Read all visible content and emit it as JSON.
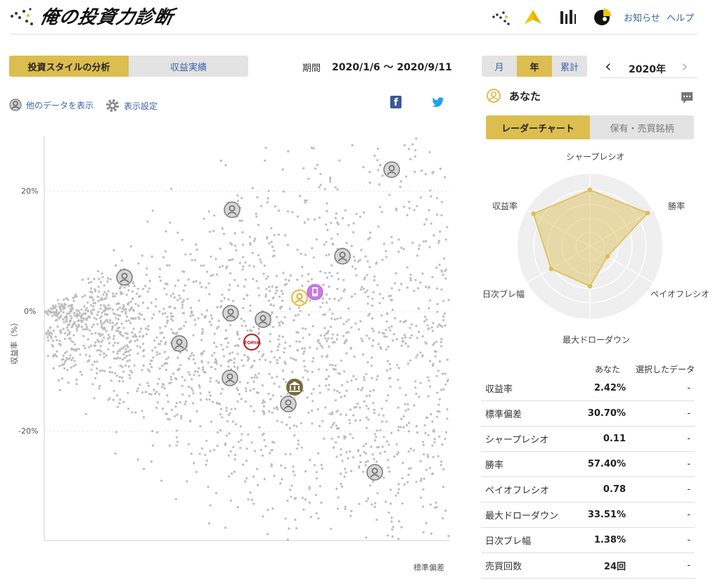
{
  "header": {
    "logo_text": "俺の投資力診断",
    "links": {
      "news": "お知らせ",
      "help": "ヘルプ"
    },
    "icons": [
      "dots-logo-icon",
      "yellow-triangle-icon",
      "bar-chart-icon",
      "pie-chart-icon"
    ]
  },
  "main_tabs": {
    "style": "投資スタイルの分析",
    "results": "収益実績"
  },
  "period": {
    "label": "期間",
    "value": "2020/1/6 〜 2020/9/11"
  },
  "range_tabs": {
    "month": "月",
    "year": "年",
    "total": "累計"
  },
  "year_nav": {
    "prev": "‹",
    "value": "2020年",
    "next": "›"
  },
  "toolbar": {
    "other_data": "他のデータを表示",
    "display_settings": "表示設定"
  },
  "share": {
    "facebook": "f",
    "twitter": "twitter"
  },
  "scatter": {
    "x_label": "標準偏差",
    "y_label": "収益率（%）",
    "y_ticks": [
      "20%",
      "0%",
      "-20%"
    ],
    "topix_label": "TOPIX"
  },
  "user_panel": {
    "title": "あなた"
  },
  "sub_tabs": {
    "radar": "レーダーチャート",
    "holdings": "保有・売買銘柄"
  },
  "radar": {
    "axes": [
      "シャープレシオ",
      "勝率",
      "ペイオフレシオ",
      "最大ドローダウン",
      "日次ブレ幅",
      "収益率"
    ],
    "values": [
      0.78,
      0.92,
      0.28,
      0.55,
      0.62,
      0.9
    ],
    "color": "#dcbd4f"
  },
  "table": {
    "headers": [
      "",
      "あなた",
      "選択したデータ"
    ],
    "rows": [
      {
        "label": "収益率",
        "you": "2.42%",
        "selected": "-"
      },
      {
        "label": "標準偏差",
        "you": "30.70%",
        "selected": "-"
      },
      {
        "label": "シャープレシオ",
        "you": "0.11",
        "selected": "-"
      },
      {
        "label": "勝率",
        "you": "57.40%",
        "selected": "-"
      },
      {
        "label": "ペイオフレシオ",
        "you": "0.78",
        "selected": "-"
      },
      {
        "label": "最大ドローダウン",
        "you": "33.51%",
        "selected": "-"
      },
      {
        "label": "日次ブレ幅",
        "you": "1.38%",
        "selected": "-"
      },
      {
        "label": "売買回数",
        "you": "24回",
        "selected": "-"
      }
    ]
  },
  "colors": {
    "accent": "#dcbd4f",
    "link": "#3a64a8",
    "tab_bg": "#e3e3e3"
  }
}
